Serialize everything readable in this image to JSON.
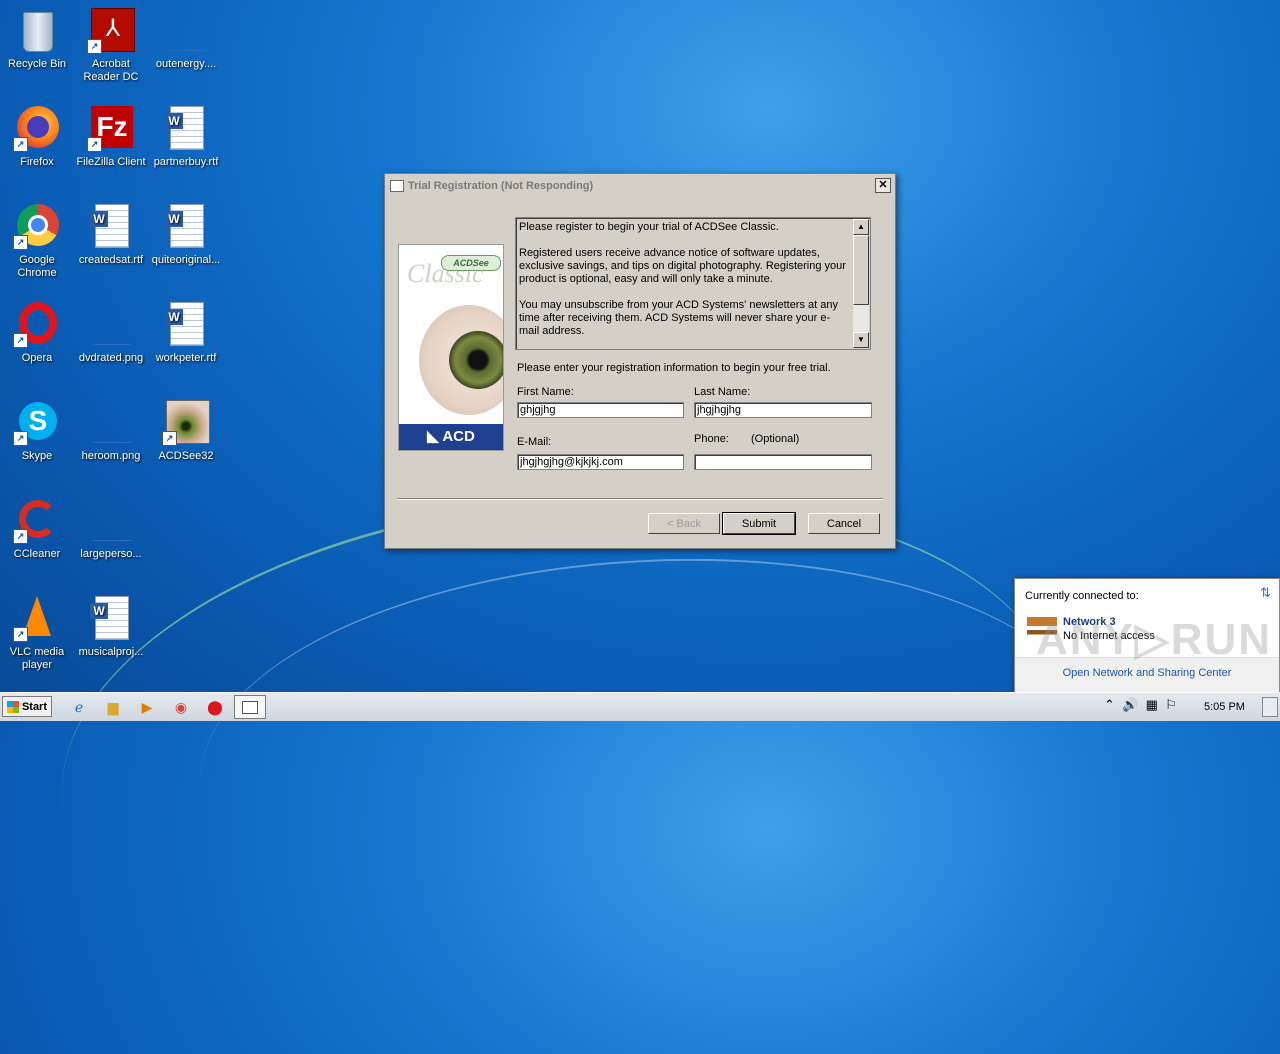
{
  "desktop": {
    "icons": [
      {
        "label": "Recycle Bin"
      },
      {
        "label": "Acrobat Reader DC"
      },
      {
        "label": "outenergy...."
      },
      {
        "label": "Firefox"
      },
      {
        "label": "FileZilla Client"
      },
      {
        "label": "partnerbuy.rtf"
      },
      {
        "label": "Google Chrome"
      },
      {
        "label": "createdsat.rtf"
      },
      {
        "label": "quiteoriginal..."
      },
      {
        "label": "Opera"
      },
      {
        "label": "dvdrated.png"
      },
      {
        "label": "workpeter.rtf"
      },
      {
        "label": "Skype"
      },
      {
        "label": "heroom.png"
      },
      {
        "label": "ACDSee32"
      },
      {
        "label": "CCleaner"
      },
      {
        "label": "largeperso..."
      },
      {
        "label": "VLC media player"
      },
      {
        "label": "musicalproj..."
      }
    ]
  },
  "dialog": {
    "title": "Trial Registration (Not Responding)",
    "close_glyph": "✕",
    "brand": {
      "badge": "ACDSee",
      "product": "Classic",
      "logo": "◣ ACD"
    },
    "info_paragraphs": [
      "Please register to begin your trial of ACDSee Classic.",
      "Registered users receive advance notice of software updates, exclusive savings, and tips on digital photography. Registering your product is optional, easy and will only take a minute.",
      "You may unsubscribe from your ACD Systems' newsletters at any time after receiving them. ACD Systems will never share your e-mail address."
    ],
    "prompt": "Please enter your registration information to begin your free trial.",
    "first_name_label": "First Name:",
    "first_name_value": "ghjgjhg",
    "last_name_label": "Last Name:",
    "last_name_value": "jhgjhgjhg",
    "email_label": "E-Mail:",
    "email_value": "jhgjhgjhg@kjkjkj.com",
    "phone_label": "Phone:",
    "phone_optional": "(Optional)",
    "phone_value": "",
    "back_label": "< Back",
    "submit_label": "Submit",
    "cancel_label": "Cancel"
  },
  "taskbar": {
    "start_label": "Start",
    "clock": "5:05 PM"
  },
  "network_popup": {
    "title": "Currently connected to:",
    "network_name": "Network  3",
    "network_status": "No Internet access",
    "link": "Open Network and Sharing Center"
  },
  "watermark": "ANY▷RUN",
  "colors": {
    "desktop_blue": "#1476cf",
    "dialog_gray": "#d4d0c8",
    "link_blue": "#1a55b0"
  }
}
